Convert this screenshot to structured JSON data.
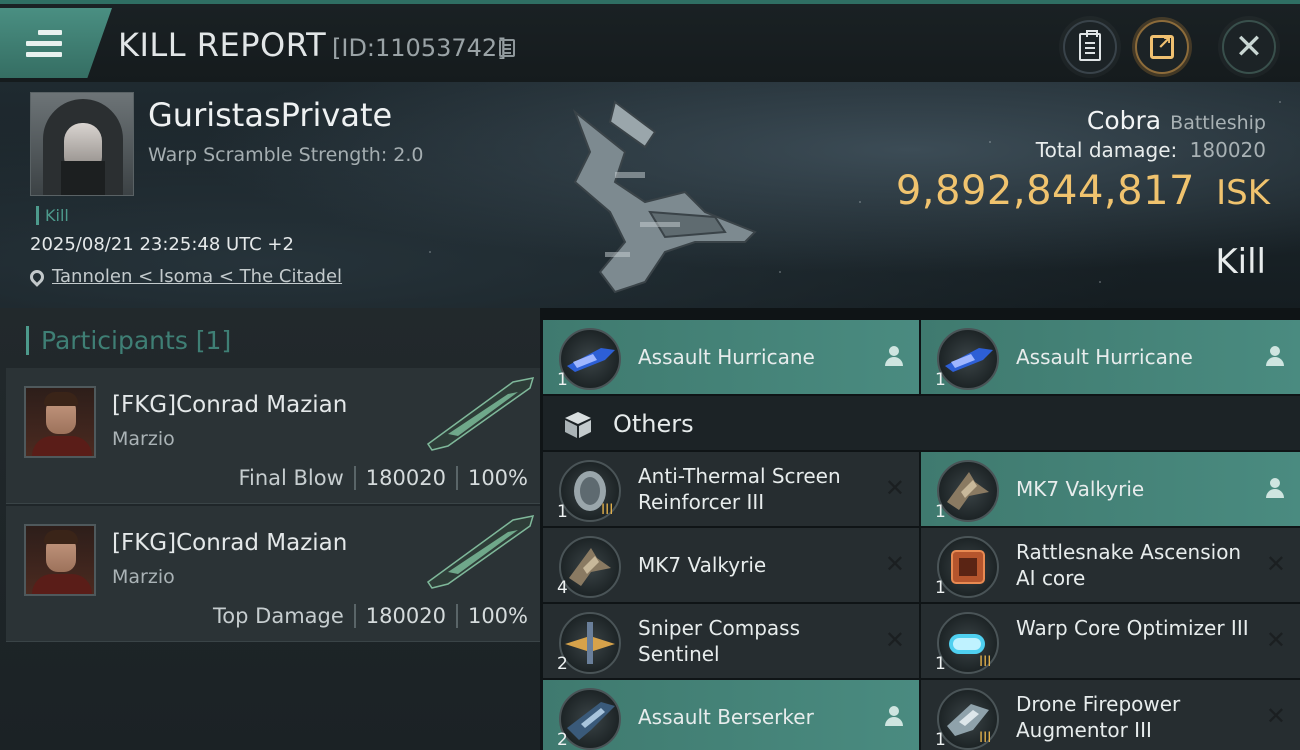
{
  "header": {
    "title": "KILL REPORT",
    "report_id": "[ID:11053742]"
  },
  "victim": {
    "name": "GuristasPrivate",
    "subtitle": "Warp Scramble Strength: 2.0",
    "tag": "Kill",
    "timestamp": "2025/08/21 23:25:48 UTC +2",
    "location": "Tannolen < Isoma < The Citadel",
    "ship_name": "Cobra",
    "ship_class": "Battleship",
    "total_damage_label": "Total damage:",
    "total_damage": "180020",
    "isk_value": "9,892,844,817",
    "isk_unit": "ISK",
    "result": "Kill"
  },
  "participants": {
    "header": "Participants [1]",
    "rows": [
      {
        "name": "[FKG]Conrad Mazian",
        "corp": "Marzio",
        "role": "Final Blow",
        "damage": "180020",
        "percent": "100%"
      },
      {
        "name": "[FKG]Conrad Mazian",
        "corp": "Marzio",
        "role": "Top Damage",
        "damage": "180020",
        "percent": "100%"
      }
    ]
  },
  "items": {
    "others_label": "Others",
    "top_row": [
      {
        "name": "Assault Hurricane",
        "qty": "1"
      },
      {
        "name": "Assault Hurricane",
        "qty": "1"
      }
    ],
    "grid": [
      {
        "name": "Anti-Thermal Screen Reinforcer III",
        "qty": "1",
        "tier": "III"
      },
      {
        "name": "MK7  Valkyrie",
        "qty": "1"
      },
      {
        "name": "MK7  Valkyrie",
        "qty": "4"
      },
      {
        "name": "Rattlesnake Ascension AI core",
        "qty": "1"
      },
      {
        "name": "Sniper Compass Sentinel",
        "qty": "2"
      },
      {
        "name": "Warp Core Optimizer III",
        "qty": "1",
        "tier": "III"
      },
      {
        "name": "Assault Berserker",
        "qty": "2"
      },
      {
        "name": "Drone Firepower Augmentor III",
        "qty": "1",
        "tier": "III"
      }
    ]
  },
  "colors": {
    "accent": "#4a8b80",
    "isk": "#f0c36e",
    "bg": "#0f1416"
  },
  "icons": [
    "menu-icon",
    "copy-icon",
    "clipboard-icon",
    "share-icon",
    "close-icon",
    "pin-icon",
    "person-icon",
    "x-icon",
    "box-icon"
  ]
}
